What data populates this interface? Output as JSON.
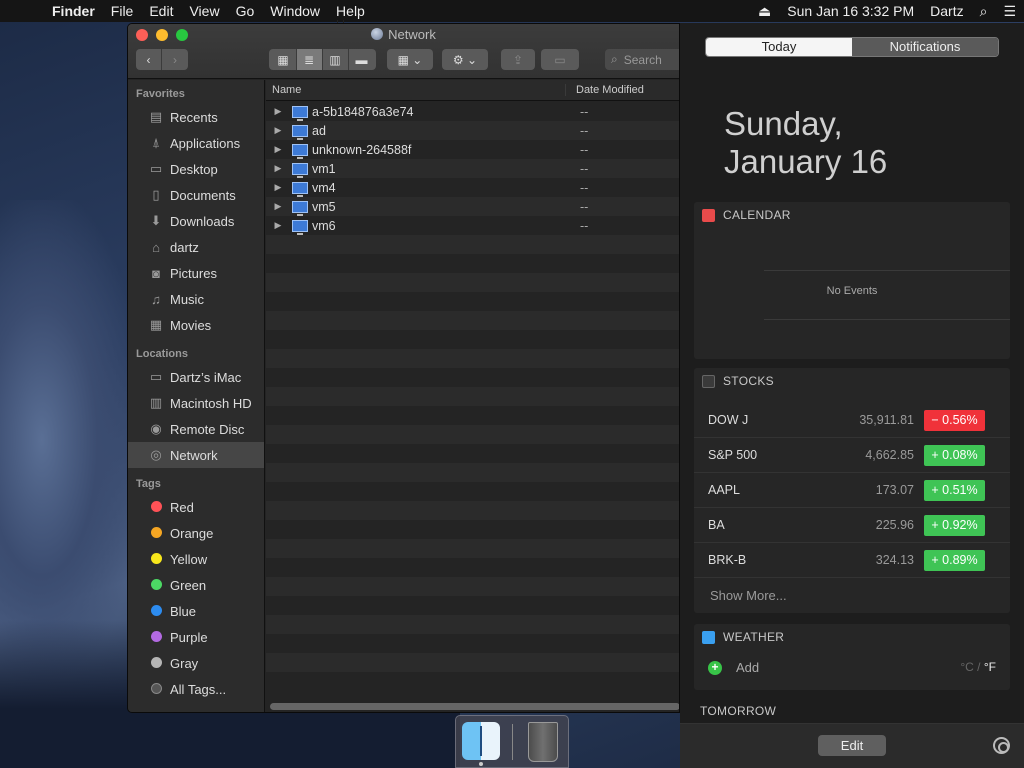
{
  "menubar": {
    "app": "Finder",
    "items": [
      "File",
      "Edit",
      "View",
      "Go",
      "Window",
      "Help"
    ],
    "clock": "Sun Jan 16  3:32 PM",
    "user": "Dartz"
  },
  "finder": {
    "title": "Network",
    "search_placeholder": "Search",
    "sidebar": {
      "favorites_heading": "Favorites",
      "favorites": [
        "Recents",
        "Applications",
        "Desktop",
        "Documents",
        "Downloads",
        "dartz",
        "Pictures",
        "Music",
        "Movies"
      ],
      "locations_heading": "Locations",
      "locations": [
        "Dartz’s iMac",
        "Macintosh HD",
        "Remote Disc",
        "Network"
      ],
      "tags_heading": "Tags",
      "tags": [
        {
          "label": "Red",
          "color": "#ff5257"
        },
        {
          "label": "Orange",
          "color": "#f5a623"
        },
        {
          "label": "Yellow",
          "color": "#f8e71c"
        },
        {
          "label": "Green",
          "color": "#4cd964"
        },
        {
          "label": "Blue",
          "color": "#2d8cf0"
        },
        {
          "label": "Purple",
          "color": "#b36ae2"
        },
        {
          "label": "Gray",
          "color": "#b5b5b5"
        }
      ],
      "all_tags": "All Tags..."
    },
    "columns": {
      "name": "Name",
      "date": "Date Modified"
    },
    "files": [
      {
        "name": "a-5b184876a3e74",
        "date": "--"
      },
      {
        "name": "ad",
        "date": "--"
      },
      {
        "name": "unknown-264588f",
        "date": "--"
      },
      {
        "name": "vm1",
        "date": "--"
      },
      {
        "name": "vm4",
        "date": "--"
      },
      {
        "name": "vm5",
        "date": "--"
      },
      {
        "name": "vm6",
        "date": "--"
      }
    ]
  },
  "nc": {
    "tabs": [
      "Today",
      "Notifications"
    ],
    "date_line1": "Sunday,",
    "date_line2": "January 16",
    "calendar": {
      "heading": "CALENDAR",
      "empty": "No Events"
    },
    "stocks": {
      "heading": "STOCKS",
      "items": [
        {
          "symbol": "DOW J",
          "price": "35,911.81",
          "change": "− 0.56%",
          "color": "#f0323a"
        },
        {
          "symbol": "S&P 500",
          "price": "4,662.85",
          "change": "+ 0.08%",
          "color": "#3fc455"
        },
        {
          "symbol": "AAPL",
          "price": "173.07",
          "change": "+ 0.51%",
          "color": "#3fc455"
        },
        {
          "symbol": "BA",
          "price": "225.96",
          "change": "+ 0.92%",
          "color": "#3fc455"
        },
        {
          "symbol": "BRK-B",
          "price": "324.13",
          "change": "+ 0.89%",
          "color": "#3fc455"
        }
      ],
      "show_more": "Show More..."
    },
    "weather": {
      "heading": "WEATHER",
      "add": "Add",
      "unit_c": "°C",
      "unit_sep": "/",
      "unit_f": "°F"
    },
    "tomorrow": "TOMORROW",
    "edit": "Edit"
  }
}
